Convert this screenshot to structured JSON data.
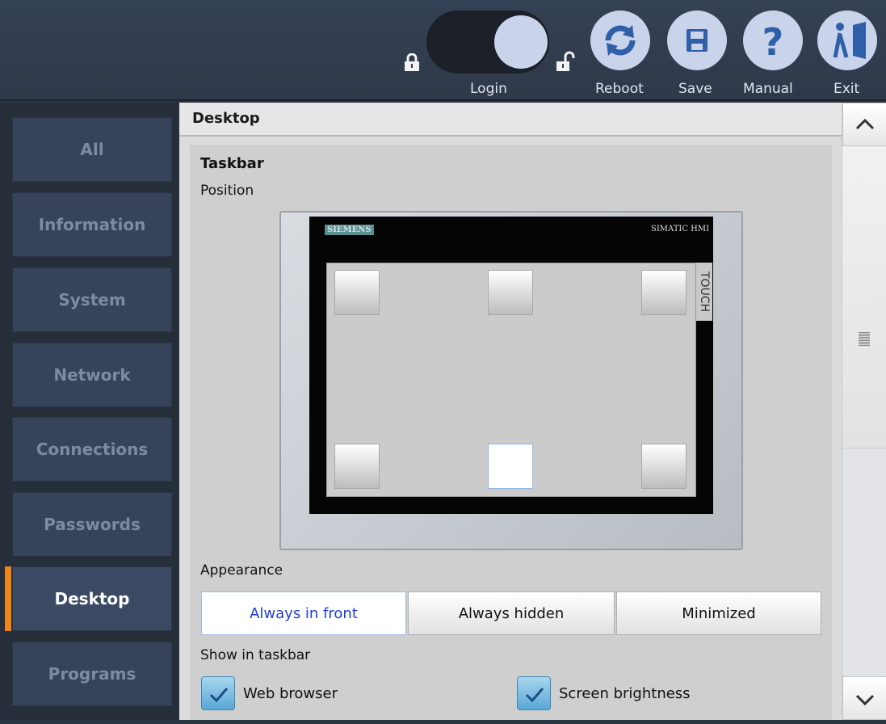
{
  "topbar": {
    "login_label": "Login",
    "reboot_label": "Reboot",
    "save_label": "Save",
    "manual_label": "Manual",
    "exit_label": "Exit",
    "icons": {
      "lock_closed": "lock-closed-icon",
      "lock_open": "lock-open-icon",
      "reboot": "refresh-icon",
      "save": "save-icon",
      "manual": "help-icon",
      "exit": "exit-door-icon"
    },
    "colors": {
      "button_bg": "#c9d3ea",
      "icon_blue": "#2e5fa8"
    }
  },
  "sidebar": {
    "items": [
      {
        "label": "All"
      },
      {
        "label": "Information"
      },
      {
        "label": "System"
      },
      {
        "label": "Network"
      },
      {
        "label": "Connections"
      },
      {
        "label": "Passwords"
      },
      {
        "label": "Desktop",
        "active": true
      },
      {
        "label": "Programs"
      }
    ],
    "accent_color": "#f08519"
  },
  "main": {
    "header_title": "Desktop",
    "section_title": "Taskbar",
    "position_label": "Position",
    "preview": {
      "brand_text": "SIEMENS",
      "model_text": "SIMATIC HMI",
      "side_text": "TOUCH",
      "selected_position": "bottom-center"
    },
    "appearance_label": "Appearance",
    "appearance_options": [
      {
        "label": "Always in front",
        "active": true
      },
      {
        "label": "Always hidden",
        "active": false
      },
      {
        "label": "Minimized",
        "active": false
      }
    ],
    "show_in_taskbar_label": "Show in taskbar",
    "checkboxes": [
      {
        "label": "Web browser",
        "checked": true
      },
      {
        "label": "Screen brightness",
        "checked": true
      }
    ]
  },
  "scrollbar": {
    "up_icon": "chevron-up-icon",
    "down_icon": "chevron-down-icon"
  }
}
